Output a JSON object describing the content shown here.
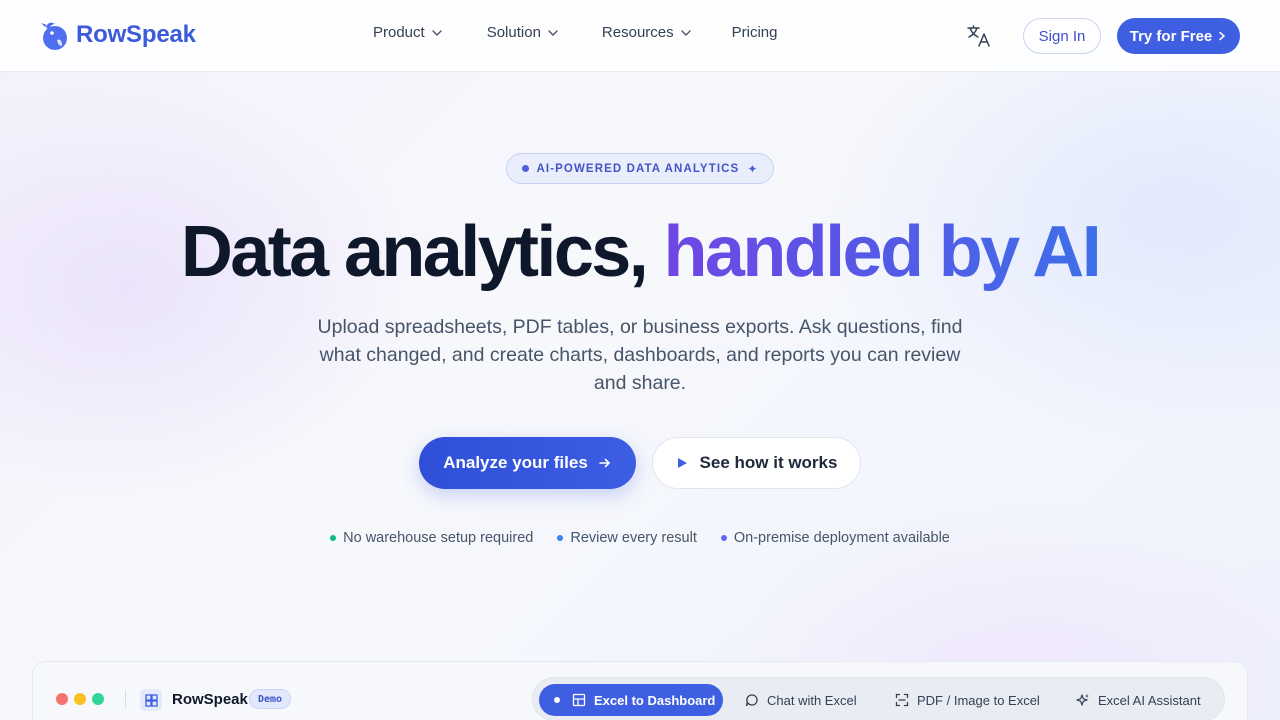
{
  "brand": {
    "name": "RowSpeak"
  },
  "nav": {
    "items": [
      {
        "label": "Product",
        "has_dropdown": true
      },
      {
        "label": "Solution",
        "has_dropdown": true
      },
      {
        "label": "Resources",
        "has_dropdown": true
      },
      {
        "label": "Pricing",
        "has_dropdown": false
      }
    ],
    "language_icon": "translate-icon",
    "sign_in": "Sign In",
    "try_free": "Try for Free"
  },
  "hero": {
    "badge": "AI-POWERED DATA ANALYTICS",
    "headline_dark": "Data analytics,",
    "headline_gradient": "handled by AI",
    "subtitle": "Upload spreadsheets, PDF tables, or business exports. Ask questions, find what changed, and create charts, dashboards, and reports you can review and share.",
    "primary_cta": "Analyze your files",
    "secondary_cta": "See how it works",
    "features": [
      {
        "label": "No warehouse setup required",
        "color": "#10b981"
      },
      {
        "label": "Review every result",
        "color": "#3b82f6"
      },
      {
        "label": "On-premise deployment available",
        "color": "#6366f1"
      }
    ]
  },
  "demo": {
    "app_name": "RowSpeak",
    "badge": "Demo",
    "tabs": [
      {
        "label": "Excel to Dashboard",
        "icon": "dashboard-icon",
        "active": true
      },
      {
        "label": "Chat with Excel",
        "icon": "chat-icon",
        "active": false
      },
      {
        "label": "PDF / Image to Excel",
        "icon": "scan-icon",
        "active": false
      },
      {
        "label": "Excel AI Assistant",
        "icon": "sparkle-icon",
        "active": false
      }
    ]
  },
  "colors": {
    "brand": "#3b5bdb",
    "primary": "#3f5fe3",
    "text_dark": "#0f172a",
    "text_muted": "#475569"
  }
}
